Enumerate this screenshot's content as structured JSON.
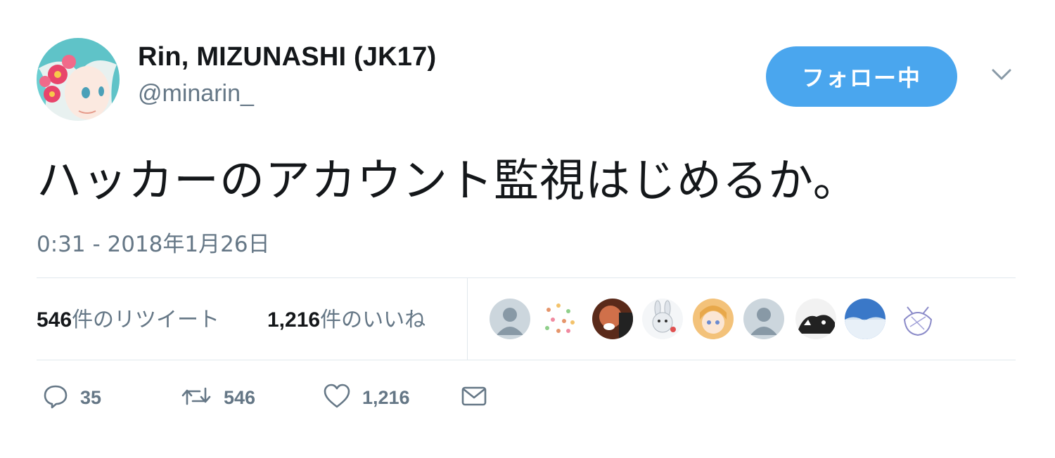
{
  "user": {
    "display_name": "Rin, MIZUNASHI (JK17)",
    "handle": "@minarin_"
  },
  "follow_button": {
    "label": "フォロー中"
  },
  "tweet": {
    "text": "ハッカーのアカウント監視はじめるか。",
    "timestamp": "0:31 - 2018年1月26日"
  },
  "stats": {
    "retweets_count": "546",
    "retweets_label": "件のリツイート",
    "likes_count": "1,216",
    "likes_label": "件のいいね"
  },
  "actions": {
    "reply_count": "35",
    "retweet_count": "546",
    "like_count": "1,216"
  },
  "icons": {
    "caret": "chevron-down-icon",
    "reply": "reply-icon",
    "retweet": "retweet-icon",
    "like": "heart-icon",
    "dm": "envelope-icon"
  },
  "colors": {
    "accent": "#4aa6ee",
    "secondary_text": "#657786",
    "divider": "#e1e8ed"
  }
}
